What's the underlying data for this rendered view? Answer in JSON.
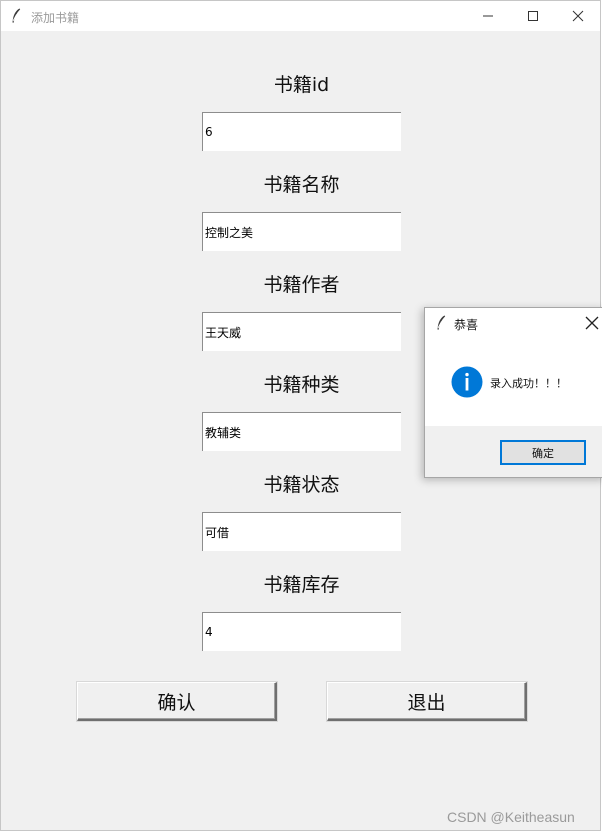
{
  "main_window": {
    "title": "添加书籍",
    "fields": [
      {
        "label": "书籍id",
        "value": "6"
      },
      {
        "label": "书籍名称",
        "value": "控制之美"
      },
      {
        "label": "书籍作者",
        "value": "王天威"
      },
      {
        "label": "书籍种类",
        "value": "教辅类"
      },
      {
        "label": "书籍状态",
        "value": "可借"
      },
      {
        "label": "书籍库存",
        "value": "4"
      }
    ],
    "confirm_label": "确认",
    "exit_label": "退出"
  },
  "message_box": {
    "title": "恭喜",
    "message": "录入成功！！！",
    "ok_label": "确定",
    "icon": "info-icon"
  },
  "watermark": "CSDN @Keitheasun",
  "colors": {
    "window_bg": "#f0f0f0",
    "entry_bg": "#ffffff",
    "info_blue": "#0078d7",
    "default_button_border": "#0078d7"
  }
}
